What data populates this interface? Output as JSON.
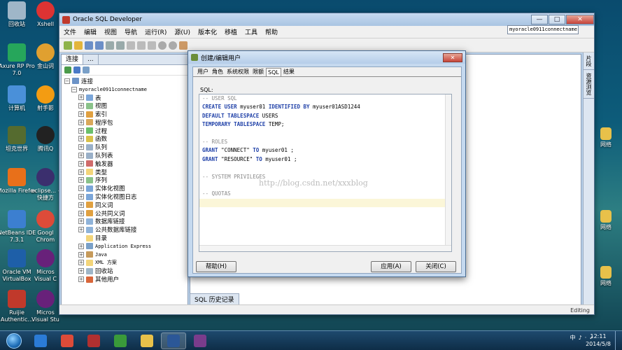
{
  "desktop": {
    "left_icons": [
      {
        "label": "回收站",
        "color": "#9fb6c8"
      },
      {
        "label": "Axure RP Pro 7.0",
        "color": "#26a65b"
      },
      {
        "label": "计算机",
        "color": "#4a90d9"
      },
      {
        "label": "坦克世界",
        "color": "#556b2f"
      },
      {
        "label": "Mozilla Firefox",
        "color": "#e8701a"
      },
      {
        "label": "NetBeans IDE 7.3.1",
        "color": "#3c7fd0"
      },
      {
        "label": "Oracle VM VirtualBox",
        "color": "#1e5fa8"
      },
      {
        "label": "Ruijie Authentic...",
        "color": "#c0392b"
      }
    ],
    "mid_icons": [
      {
        "label": "Xshell",
        "color": "#d33"
      },
      {
        "label": "金山词",
        "color": "#e0a030"
      },
      {
        "label": "射手影",
        "color": "#f39c12"
      },
      {
        "label": "腾讯Q",
        "color": "#222"
      },
      {
        "label": "eclipse... - 快捷方",
        "color": "#3b2f6e"
      },
      {
        "label": "Googl Chrom",
        "color": "#dd4b39"
      },
      {
        "label": "Micros Visual C",
        "color": "#68217a"
      },
      {
        "label": "Micros Visual Stu",
        "color": "#68217a"
      }
    ],
    "right_icons": [
      {
        "label": "网络"
      },
      {
        "label": "网络"
      },
      {
        "label": "网络"
      }
    ]
  },
  "window": {
    "title": "Oracle SQL Developer",
    "buttons": {
      "minimize": "—",
      "maximize": "□",
      "close": "✕"
    },
    "menu": [
      "文件",
      "编辑",
      "视图",
      "导航",
      "运行(R)",
      "源(U)",
      "版本化",
      "移植",
      "工具",
      "帮助"
    ],
    "left_tabs": [
      "连接",
      "..."
    ],
    "tree_root": "连接",
    "connection_name": "myoracle0911connectname",
    "tree_items": [
      {
        "label": "表",
        "expanded": false
      },
      {
        "label": "视图",
        "expanded": false
      },
      {
        "label": "索引",
        "expanded": false
      },
      {
        "label": "程序包",
        "expanded": false
      },
      {
        "label": "过程",
        "expanded": false
      },
      {
        "label": "函数",
        "expanded": false
      },
      {
        "label": "队列",
        "expanded": false
      },
      {
        "label": "队列表",
        "expanded": false
      },
      {
        "label": "触发器",
        "expanded": false
      },
      {
        "label": "类型",
        "expanded": false
      },
      {
        "label": "序列",
        "expanded": false
      },
      {
        "label": "实体化视图",
        "expanded": false
      },
      {
        "label": "实体化视图日志",
        "expanded": false
      },
      {
        "label": "同义词",
        "expanded": false
      },
      {
        "label": "公共同义词",
        "expanded": false
      },
      {
        "label": "数据库链接",
        "expanded": false
      },
      {
        "label": "公共数据库链接",
        "expanded": false
      },
      {
        "label": "目录",
        "expanded": null
      },
      {
        "label": "Application Express",
        "expanded": false
      },
      {
        "label": "Java",
        "expanded": false
      },
      {
        "label": "XML 方案",
        "expanded": false
      },
      {
        "label": "回收站",
        "expanded": false
      },
      {
        "label": "其他用户",
        "expanded": false
      }
    ],
    "connection_dropdown": "myoracle0911connectname",
    "right_sidebar_tabs": [
      "片段",
      "资源浏览"
    ],
    "history_tab": "SQL 历史记录",
    "status": "Editing"
  },
  "dialog": {
    "title": "创建/编辑用户",
    "close": "✕",
    "tabs": [
      "用户",
      "角色",
      "系统权限",
      "限额",
      "SQL",
      "结果"
    ],
    "active_tab": "SQL",
    "sql_label": "SQL:",
    "sql_lines": [
      {
        "type": "comment",
        "text": "-- USER SQL"
      },
      {
        "type": "code",
        "parts": [
          {
            "k": "CREATE USER"
          },
          {
            "t": " myuser01 "
          },
          {
            "k": "IDENTIFIED BY"
          },
          {
            "t": " myuser01ASD1244"
          }
        ]
      },
      {
        "type": "code",
        "parts": [
          {
            "k": "DEFAULT TABLESPACE"
          },
          {
            "t": " USERS"
          }
        ]
      },
      {
        "type": "code",
        "parts": [
          {
            "k": "TEMPORARY TABLESPACE"
          },
          {
            "t": " TEMP;"
          }
        ]
      },
      {
        "type": "blank",
        "text": ""
      },
      {
        "type": "comment",
        "text": "-- ROLES"
      },
      {
        "type": "code",
        "parts": [
          {
            "k": "GRANT"
          },
          {
            "t": " \"CONNECT\" "
          },
          {
            "k": "TO"
          },
          {
            "t": " myuser01 ;"
          }
        ]
      },
      {
        "type": "code",
        "parts": [
          {
            "k": "GRANT"
          },
          {
            "t": " \"RESOURCE\" "
          },
          {
            "k": "TO"
          },
          {
            "t": " myuser01 ;"
          }
        ]
      },
      {
        "type": "blank",
        "text": ""
      },
      {
        "type": "comment",
        "text": "-- SYSTEM PRIVILEGES"
      },
      {
        "type": "blank",
        "text": ""
      },
      {
        "type": "comment",
        "text": "-- QUOTAS"
      },
      {
        "type": "current",
        "text": ""
      }
    ],
    "watermark": "http://blog.csdn.net/xxxblog",
    "help_button": "帮助(H)",
    "apply_button": "应用(A)",
    "close_button": "关闭(C)"
  },
  "taskbar": {
    "apps": [
      {
        "name": "ie",
        "color": "#2b7bd6"
      },
      {
        "name": "chrome",
        "color": "#dd4b39"
      },
      {
        "name": "app-red",
        "color": "#b03030"
      },
      {
        "name": "app-green",
        "color": "#3a9a3a"
      },
      {
        "name": "explorer",
        "color": "#e8c14a"
      },
      {
        "name": "word",
        "color": "#2b5797"
      },
      {
        "name": "app-purple",
        "color": "#7a3c8c"
      }
    ],
    "tray": [
      "中",
      "♪",
      "·",
      "✓"
    ],
    "time": "12:11",
    "date": "2014/5/8"
  }
}
